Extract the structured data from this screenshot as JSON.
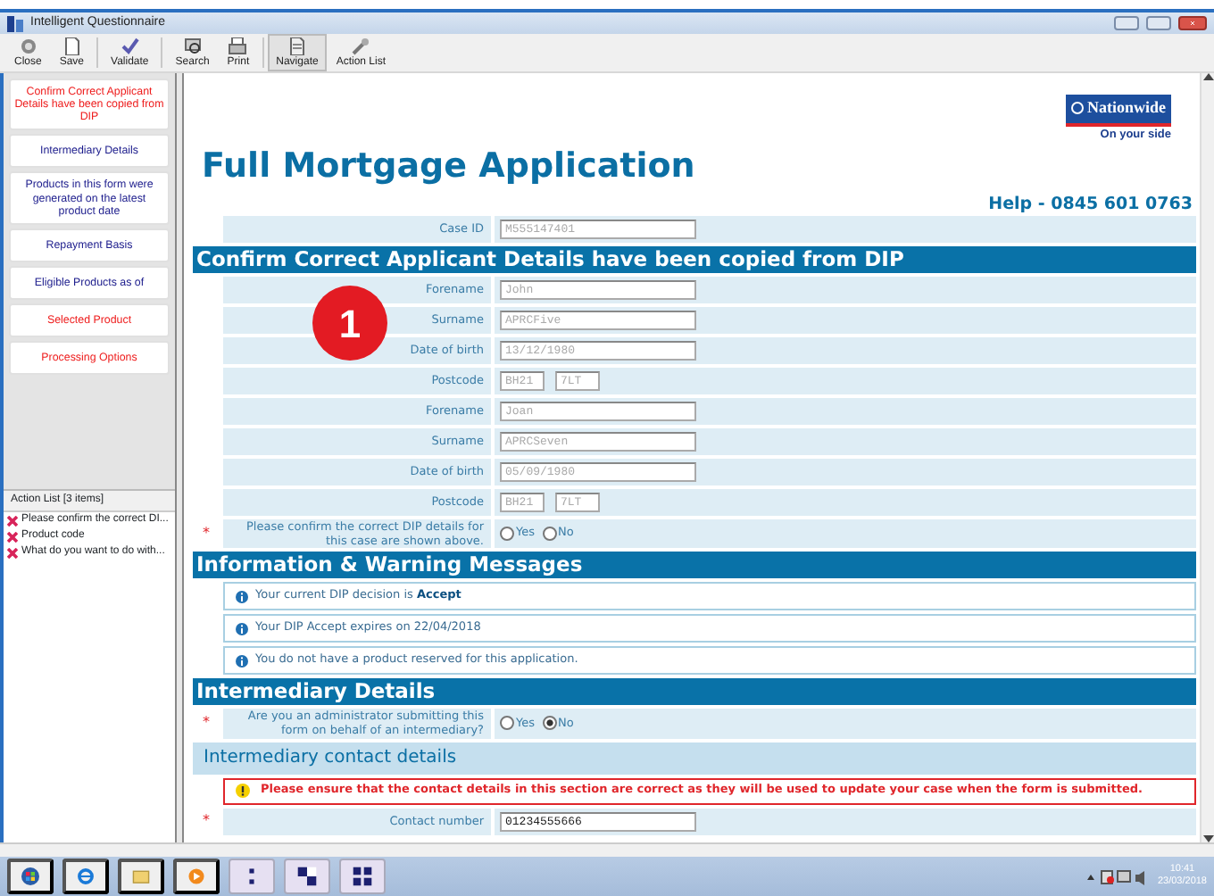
{
  "window": {
    "title": "Intelligent Questionnaire"
  },
  "toolbar": [
    {
      "label": "Close",
      "kind": "close",
      "selected": false
    },
    {
      "label": "Save",
      "kind": "save",
      "selected": false
    },
    {
      "label": "Validate",
      "kind": "validate",
      "selected": false
    },
    {
      "label": "Search",
      "kind": "search",
      "selected": false
    },
    {
      "label": "Print",
      "kind": "print",
      "selected": false
    },
    {
      "label": "Navigate",
      "kind": "navigate",
      "selected": true
    },
    {
      "label": "Action List",
      "kind": "actionlist",
      "selected": false
    }
  ],
  "sidebar": {
    "items": [
      {
        "label": "Confirm Correct Applicant Details have been copied from DIP",
        "color": "#ee1c1c"
      },
      {
        "label": "Intermediary Details",
        "color": "#1c1c8c"
      },
      {
        "label": "Products in this form were generated on the latest product date",
        "color": "#1c1c8c"
      },
      {
        "label": "Repayment Basis",
        "color": "#1c1c8c"
      },
      {
        "label": "Eligible Products as of",
        "color": "#1c1c8c"
      },
      {
        "label": "Selected Product",
        "color": "#ee1c1c"
      },
      {
        "label": "Processing Options",
        "color": "#ee1c1c"
      }
    ]
  },
  "action_list": {
    "title": "Action List [3 items]",
    "items": [
      "Please confirm the correct DI...",
      "Product code",
      "What do you want to do with..."
    ]
  },
  "form": {
    "logo": {
      "name": "Nationwide",
      "tagline": "On your side"
    },
    "title": "Full Mortgage Application",
    "help": "Help - 0845 601 0763",
    "blocks": [
      {
        "kind": "field",
        "label": "Case ID",
        "values": [
          "M555147401"
        ],
        "disabled": true
      },
      {
        "kind": "heading",
        "label": "Confirm Correct Applicant Details have been copied from DIP"
      },
      {
        "kind": "field",
        "label": "Forename",
        "values": [
          "John"
        ],
        "disabled": true
      },
      {
        "kind": "field",
        "label": "Surname",
        "values": [
          "APRCFive"
        ],
        "disabled": true
      },
      {
        "kind": "field",
        "label": "Date of birth",
        "values": [
          "13/12/1980"
        ],
        "disabled": true
      },
      {
        "kind": "field",
        "label": "Postcode",
        "values": [
          "BH21",
          "7LT"
        ],
        "disabled": true
      },
      {
        "kind": "field",
        "label": "Forename",
        "values": [
          "Joan"
        ],
        "disabled": true
      },
      {
        "kind": "field",
        "label": "Surname",
        "values": [
          "APRCSeven"
        ],
        "disabled": true
      },
      {
        "kind": "field",
        "label": "Date of birth",
        "values": [
          "05/09/1980"
        ],
        "disabled": true
      },
      {
        "kind": "field",
        "label": "Postcode",
        "values": [
          "BH21",
          "7LT"
        ],
        "disabled": true
      },
      {
        "kind": "radio",
        "label": "Please confirm the correct DIP details for this case are shown above.",
        "required_mark": "*",
        "options": [
          {
            "label": "Yes",
            "selected": false
          },
          {
            "label": "No",
            "selected": false
          }
        ]
      },
      {
        "kind": "heading",
        "label": "Information & Warning Messages"
      },
      {
        "kind": "info",
        "label": "Your current DIP decision is **Accept**"
      },
      {
        "kind": "info",
        "label": "Your DIP Accept expires on 22/04/2018"
      },
      {
        "kind": "info",
        "label": "You do not have a product reserved for this application."
      },
      {
        "kind": "heading",
        "label": "Intermediary Details"
      },
      {
        "kind": "radio",
        "label": "Are you an administrator submitting this form on behalf of an intermediary?",
        "required_mark": "*",
        "options": [
          {
            "label": "Yes",
            "selected": false
          },
          {
            "label": "No",
            "selected": true
          }
        ]
      },
      {
        "kind": "subheading",
        "label": "Intermediary contact details"
      },
      {
        "kind": "warning",
        "label": "Please ensure that the contact details in this section are correct as they will be used to update your case when the form is submitted."
      },
      {
        "kind": "field",
        "label": "Contact number",
        "values": [
          "01234555666"
        ],
        "disabled": false,
        "required_mark": "*"
      }
    ]
  },
  "callout": {
    "label": "1"
  },
  "taskbar": {
    "time": "10:41",
    "date": "23/03/2018"
  }
}
